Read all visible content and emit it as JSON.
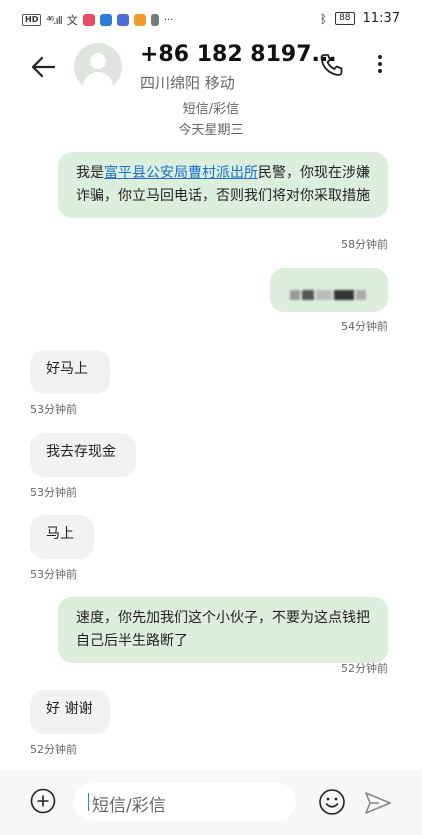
{
  "status_bar": {
    "network": "HD",
    "signal": "⁴⁶.ıll",
    "battery": "88",
    "time": "11:37",
    "more": "···"
  },
  "header": {
    "contact_name": "+86 182 8197...",
    "location": "四川绵阳 移动",
    "message_type": "短信/彩信",
    "date": "今天星期三"
  },
  "messages": [
    {
      "direction": "out",
      "text_parts": [
        "我是",
        "富平县公安局曹村派出所",
        "民警，你现在涉嫌诈骗，你立马回电话，否则我们将对你采取措施"
      ],
      "time": "58分钟前"
    },
    {
      "direction": "out",
      "text": "[redacted]",
      "time": "54分钟前"
    },
    {
      "direction": "in",
      "text": "好马上",
      "time": "53分钟前"
    },
    {
      "direction": "in",
      "text": "我去存现金",
      "time": "53分钟前"
    },
    {
      "direction": "in",
      "text": "马上",
      "time": "53分钟前"
    },
    {
      "direction": "out",
      "text": "速度，你先加我们这个小伙子，不要为这点钱把自己后半生路断了",
      "time": "52分钟前"
    },
    {
      "direction": "in",
      "text": "好 谢谢",
      "time": "52分钟前"
    }
  ],
  "input": {
    "placeholder": "短信/彩信"
  },
  "colors": {
    "outgoing_bubble": "#dcefdc",
    "incoming_bubble": "#f2f2f2",
    "link": "#1d6fd1"
  }
}
